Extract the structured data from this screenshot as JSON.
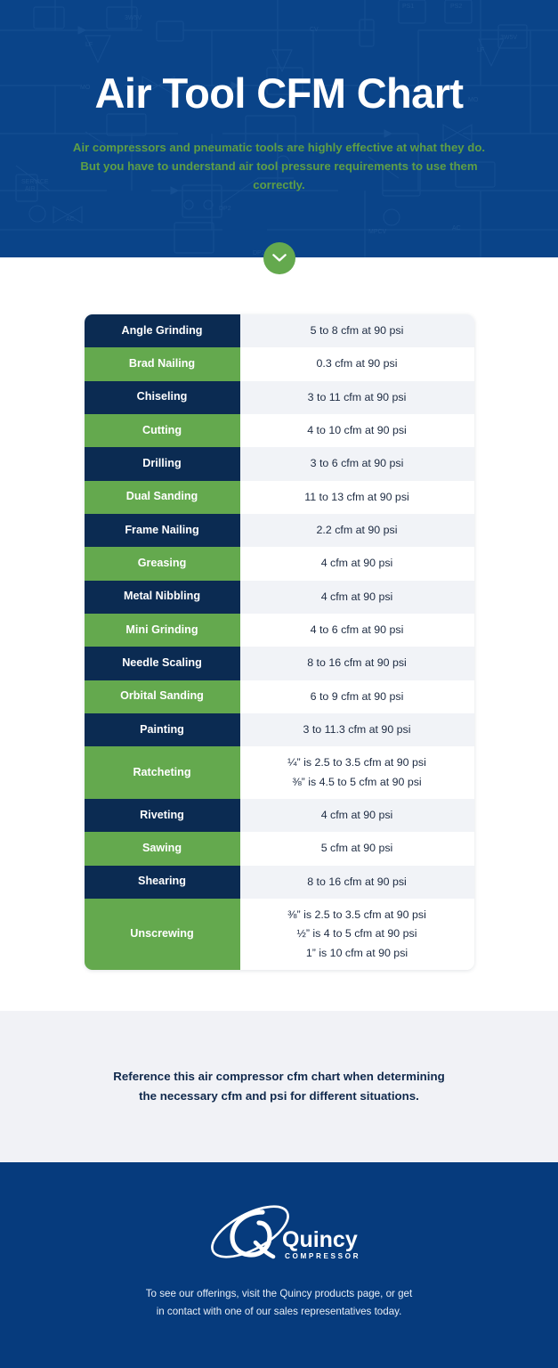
{
  "hero": {
    "title": "Air Tool CFM Chart",
    "subtitle": "Air compressors and pneumatic tools are highly effective at what they do. But you have to understand air tool pressure requirements to use them correctly.",
    "scroll_icon": "chevron-down-icon",
    "bg_color": "#0a4489",
    "title_color": "#ffffff",
    "subtitle_color": "#5e9e46",
    "scroll_button_color": "#64a94e"
  },
  "table": {
    "navy_color": "#0b2b52",
    "green_color": "#64a94e",
    "value_alt_color": "#f1f3f7",
    "rows": [
      {
        "tool": "Angle Grinding",
        "style": "navy",
        "values": [
          "5 to 8 cfm at 90 psi"
        ]
      },
      {
        "tool": "Brad Nailing",
        "style": "green",
        "values": [
          "0.3 cfm at 90 psi"
        ]
      },
      {
        "tool": "Chiseling",
        "style": "navy",
        "values": [
          "3 to 11 cfm at 90 psi"
        ]
      },
      {
        "tool": "Cutting",
        "style": "green",
        "values": [
          "4 to 10 cfm at 90 psi"
        ]
      },
      {
        "tool": "Drilling",
        "style": "navy",
        "values": [
          "3 to 6 cfm at 90 psi"
        ]
      },
      {
        "tool": "Dual Sanding",
        "style": "green",
        "values": [
          "11 to 13 cfm at 90 psi"
        ]
      },
      {
        "tool": "Frame Nailing",
        "style": "navy",
        "values": [
          "2.2 cfm at 90 psi"
        ]
      },
      {
        "tool": "Greasing",
        "style": "green",
        "values": [
          "4 cfm at 90 psi"
        ]
      },
      {
        "tool": "Metal Nibbling",
        "style": "navy",
        "values": [
          "4 cfm at 90 psi"
        ]
      },
      {
        "tool": "Mini Grinding",
        "style": "green",
        "values": [
          "4 to 6 cfm at 90 psi"
        ]
      },
      {
        "tool": "Needle Scaling",
        "style": "navy",
        "values": [
          "8 to 16 cfm at 90 psi"
        ]
      },
      {
        "tool": "Orbital Sanding",
        "style": "green",
        "values": [
          "6 to 9 cfm at 90 psi"
        ]
      },
      {
        "tool": "Painting",
        "style": "navy",
        "values": [
          "3 to 11.3 cfm at 90 psi"
        ]
      },
      {
        "tool": "Ratcheting",
        "style": "green",
        "values": [
          "¼” is 2.5 to 3.5 cfm at 90 psi",
          "⅜” is 4.5 to 5 cfm at 90 psi"
        ]
      },
      {
        "tool": "Riveting",
        "style": "navy",
        "values": [
          "4 cfm at 90 psi"
        ]
      },
      {
        "tool": "Sawing",
        "style": "green",
        "values": [
          "5 cfm at 90 psi"
        ]
      },
      {
        "tool": "Shearing",
        "style": "navy",
        "values": [
          "8 to 16 cfm at 90 psi"
        ]
      },
      {
        "tool": "Unscrewing",
        "style": "green",
        "values": [
          "⅜” is 2.5 to 3.5 cfm at 90 psi",
          "½” is 4 to 5 cfm at 90 psi",
          "1” is 10 cfm at 90 psi"
        ]
      }
    ]
  },
  "reference": {
    "lines": [
      "Reference this air compressor cfm chart when determining",
      "the necessary cfm and psi for different situations."
    ],
    "bg_color": "#f1f2f6",
    "text_color": "#10294c"
  },
  "footer": {
    "logo_name": "Quincy",
    "logo_subtitle": "COMPRESSOR",
    "lines": [
      "To see our offerings, visit the Quincy products page, or get",
      "in contact with one of our sales representatives today."
    ],
    "bg_color": "#063b7d"
  }
}
